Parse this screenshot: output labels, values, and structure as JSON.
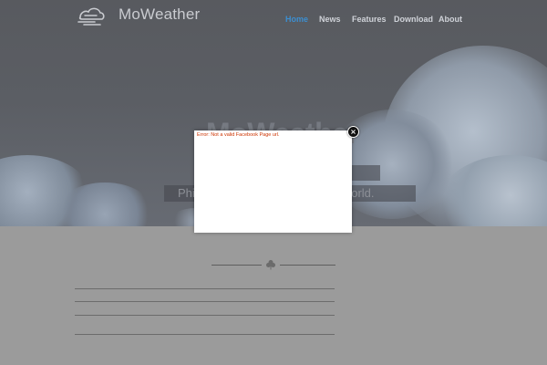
{
  "header": {
    "brand": "MoWeather",
    "nav": [
      {
        "label": "Home",
        "active": true
      },
      {
        "label": "News",
        "active": false
      },
      {
        "label": "Features",
        "active": false
      },
      {
        "label": "Download",
        "active": false
      },
      {
        "label": "About",
        "active": false
      }
    ]
  },
  "hero": {
    "title": "MoWeather",
    "tagline_left": "Phi",
    "tagline_right": "e world."
  },
  "modal": {
    "error_text": "Error: Not a valid Facebook Page url.",
    "close_symbol": "×"
  },
  "colors": {
    "nav_active": "#3c8ed0",
    "error": "#cc3300"
  }
}
